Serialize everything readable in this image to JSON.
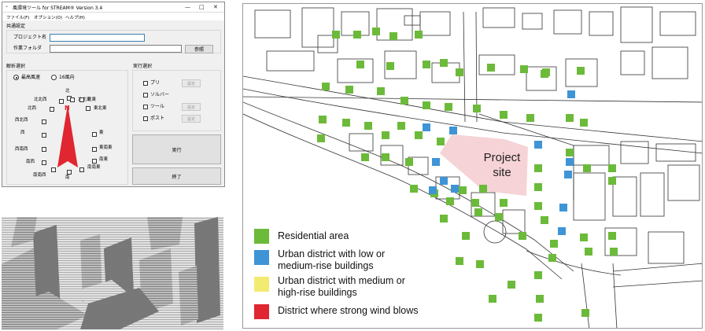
{
  "dialog": {
    "title": "風環境ツール for STREAM® Version 3.4",
    "menu": [
      "ファイル(F)",
      "オプション(O)",
      "ヘルプ(H)"
    ],
    "window_buttons": [
      "—",
      "□",
      "✕"
    ],
    "common_settings": {
      "header": "共通設定",
      "project_label": "プロジェクト名",
      "project_value": "",
      "folder_label": "作業フォルダ",
      "folder_value": "",
      "browse_label": "参照"
    },
    "analysis": {
      "header": "解析選択",
      "radio_most": "最高風速",
      "radio_16": "16風向",
      "radio_selected": "最高風速",
      "north_marker": "N",
      "directions": [
        "北",
        "北北東",
        "北東",
        "東北東",
        "東",
        "東南東",
        "南東",
        "南南東",
        "南",
        "南南西",
        "南西",
        "西南西",
        "西",
        "西北西",
        "北西",
        "北北西"
      ]
    },
    "execution": {
      "header": "実行選択",
      "items": [
        {
          "label": "プリ",
          "setting": "設定"
        },
        {
          "label": "ソルバー",
          "setting": ""
        },
        {
          "label": "ツール",
          "setting": "設定"
        },
        {
          "label": "ポスト",
          "setting": "設定"
        }
      ],
      "run_label": "実行",
      "exit_label": "終了"
    }
  },
  "map": {
    "site_label": "Project\nsite",
    "legend": [
      {
        "label": "Residential area",
        "color": "#6cba3a"
      },
      {
        "label": "Urban district with low or\nmedium-rise buildings",
        "color": "#3f94d6"
      },
      {
        "label": "Urban district with medium or\nhigh-rise buildings",
        "color": "#f3ea72"
      },
      {
        "label": "District where strong wind blows",
        "color": "#e02630"
      }
    ],
    "colors": {
      "residential": "#6cba3a",
      "urban_low": "#3f94d6",
      "site": "#f6d3d6"
    }
  }
}
